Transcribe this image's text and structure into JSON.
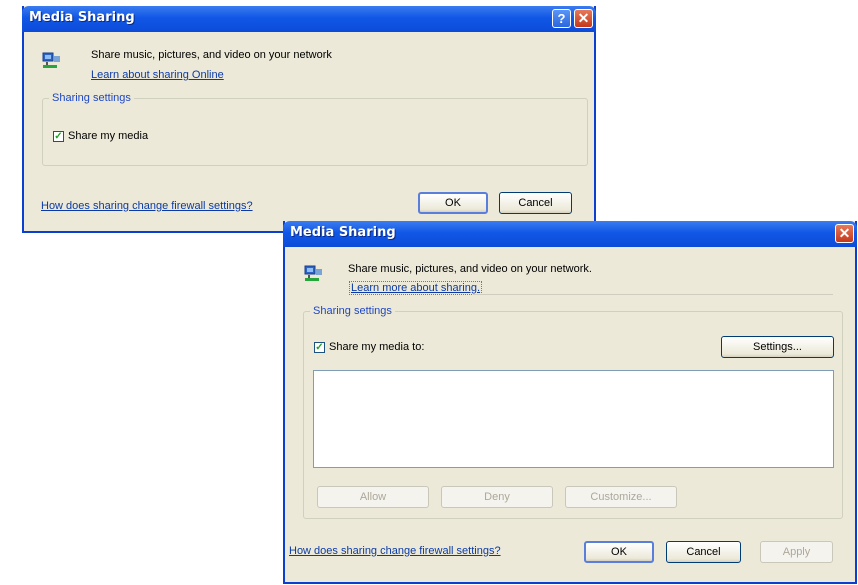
{
  "dialog1": {
    "title": "Media Sharing",
    "help_glyph": "?",
    "close_glyph": "✕",
    "description": "Share music, pictures, and video on your network",
    "learn_link": "Learn about sharing Online",
    "group_title": "Sharing settings",
    "share_label": "Share my media",
    "share_checked": true,
    "firewall_link": "How does sharing change firewall settings?",
    "ok_label": "OK",
    "cancel_label": "Cancel"
  },
  "dialog2": {
    "title": "Media Sharing",
    "close_glyph": "✕",
    "description": "Share music, pictures, and video on your network.",
    "learn_link": "Learn more about sharing.",
    "group_title": "Sharing settings",
    "share_label": "Share my media to:",
    "share_checked": true,
    "settings_label": "Settings...",
    "allow_label": "Allow",
    "deny_label": "Deny",
    "customize_label": "Customize...",
    "firewall_link": "How does sharing change firewall settings?",
    "ok_label": "OK",
    "cancel_label": "Cancel",
    "apply_label": "Apply"
  },
  "icons": {
    "network_icon": "network-media-icon",
    "check_glyph": "✓"
  },
  "colors": {
    "titlebar": "#0c4bd9",
    "dialog_bg": "#ece9d8",
    "link": "#0b3aa6",
    "group_title": "#1e47c4"
  }
}
